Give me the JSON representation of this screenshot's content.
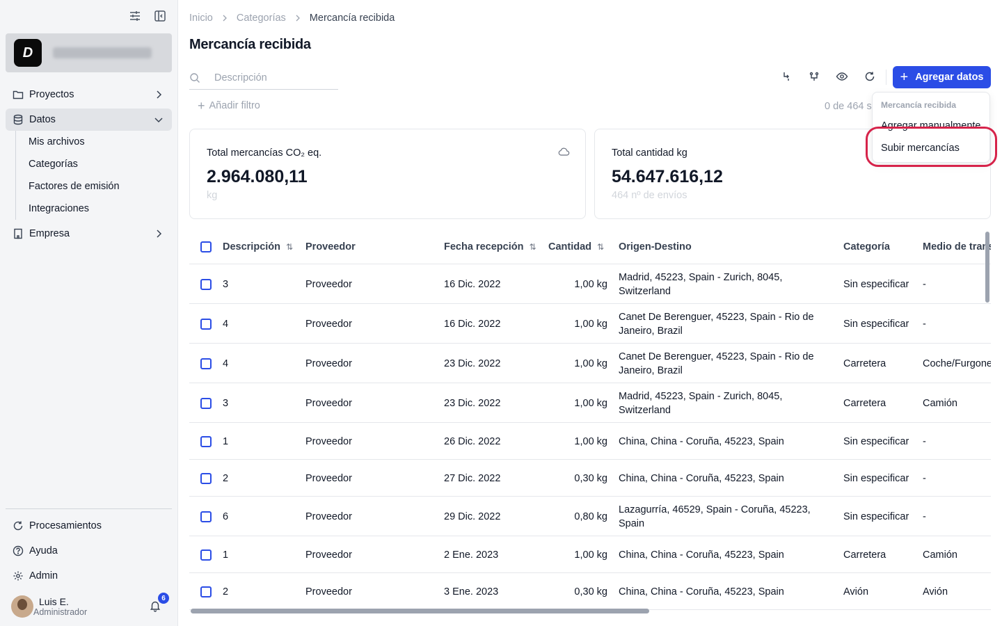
{
  "sidebar": {
    "org_initial": "D",
    "items": [
      {
        "label": "Proyectos"
      },
      {
        "label": "Datos"
      },
      {
        "label": "Empresa"
      }
    ],
    "data_subitems": [
      "Mis archivos",
      "Categorías",
      "Factores de emisión",
      "Integraciones"
    ],
    "bottom_items": [
      {
        "label": "Procesamientos"
      },
      {
        "label": "Ayuda"
      },
      {
        "label": "Admin"
      }
    ],
    "user": {
      "name": "Luis E.",
      "role": "Administrador",
      "notifications": "6"
    }
  },
  "breadcrumb": [
    "Inicio",
    "Categorías",
    "Mercancía recibida"
  ],
  "page_title": "Mercancía recibida",
  "search": {
    "placeholder": "Descripción"
  },
  "add_filter_label": "Añadir filtro",
  "add_button_label": "Agregar datos",
  "count_text": "0 de 464 s",
  "cards": [
    {
      "label": "Total mercancías CO₂ eq.",
      "value": "2.964.080,11",
      "unit": "kg"
    },
    {
      "label": "Total cantidad kg",
      "value": "54.647.616,12",
      "unit": "464 nº de envíos"
    }
  ],
  "dropdown": {
    "header": "Mercancía recibida",
    "items": [
      "Agregar manualmente",
      "Subir mercancías"
    ]
  },
  "table": {
    "columns": [
      "Descripción",
      "Proveedor",
      "Fecha recepción",
      "Cantidad",
      "Origen-Destino",
      "Categoría",
      "Medio de trans"
    ],
    "rows": [
      {
        "desc": "3",
        "prov": "Proveedor",
        "fecha": "16 Dic. 2022",
        "cant": "1,00 kg",
        "origen1": "Madrid, 45223, Spain - Zurich, 8045,",
        "origen2": "Switzerland",
        "cat": "Sin especificar",
        "medio": "-"
      },
      {
        "desc": "4",
        "prov": "Proveedor",
        "fecha": "16 Dic. 2022",
        "cant": "1,00 kg",
        "origen1": "Canet De Berenguer, 45223, Spain - Rio de",
        "origen2": "Janeiro, Brazil",
        "cat": "Sin especificar",
        "medio": "-"
      },
      {
        "desc": "4",
        "prov": "Proveedor",
        "fecha": "23 Dic. 2022",
        "cant": "1,00 kg",
        "origen1": "Canet De Berenguer, 45223, Spain - Rio de",
        "origen2": "Janeiro, Brazil",
        "cat": "Carretera",
        "medio": "Coche/Furgone"
      },
      {
        "desc": "3",
        "prov": "Proveedor",
        "fecha": "23 Dic. 2022",
        "cant": "1,00 kg",
        "origen1": "Madrid, 45223, Spain - Zurich, 8045,",
        "origen2": "Switzerland",
        "cat": "Carretera",
        "medio": "Camión"
      },
      {
        "desc": "1",
        "prov": "Proveedor",
        "fecha": "26 Dic. 2022",
        "cant": "1,00 kg",
        "origen1": "China, China - Coruña, 45223, Spain",
        "origen2": "",
        "cat": "Sin especificar",
        "medio": "-"
      },
      {
        "desc": "2",
        "prov": "Proveedor",
        "fecha": "27 Dic. 2022",
        "cant": "0,30 kg",
        "origen1": "China, China - Coruña, 45223, Spain",
        "origen2": "",
        "cat": "Sin especificar",
        "medio": "-"
      },
      {
        "desc": "6",
        "prov": "Proveedor",
        "fecha": "29 Dic. 2022",
        "cant": "0,80 kg",
        "origen1": "Lazagurría, 46529, Spain - Coruña, 45223,",
        "origen2": "Spain",
        "cat": "Sin especificar",
        "medio": "-"
      },
      {
        "desc": "1",
        "prov": "Proveedor",
        "fecha": "2 Ene. 2023",
        "cant": "1,00 kg",
        "origen1": "China, China - Coruña, 45223, Spain",
        "origen2": "",
        "cat": "Carretera",
        "medio": "Camión"
      },
      {
        "desc": "2",
        "prov": "Proveedor",
        "fecha": "3 Ene. 2023",
        "cant": "0,30 kg",
        "origen1": "China, China - Coruña, 45223, Spain",
        "origen2": "",
        "cat": "Avión",
        "medio": "Avión"
      }
    ]
  },
  "colors": {
    "accent": "#2b4de6",
    "highlight": "#d6234a"
  }
}
